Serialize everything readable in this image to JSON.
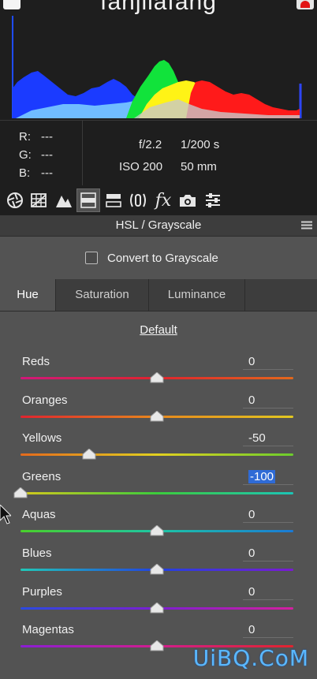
{
  "histogram": {
    "title_partial": "fanjilafang"
  },
  "info": {
    "r_label": "R:",
    "g_label": "G:",
    "b_label": "B:",
    "r_value": "---",
    "g_value": "---",
    "b_value": "---",
    "aperture": "f/2.2",
    "shutter": "1/200 s",
    "iso": "ISO 200",
    "focal_length": "50 mm"
  },
  "toolbar": {
    "active_tool": "hsl-grayscale"
  },
  "panel": {
    "title": "HSL / Grayscale",
    "convert_label": "Convert to Grayscale",
    "convert_checked": false
  },
  "tabs": {
    "hue": "Hue",
    "saturation": "Saturation",
    "luminance": "Luminance",
    "active": "Hue"
  },
  "default_label": "Default",
  "sliders": {
    "range": [
      -100,
      100
    ],
    "items": [
      {
        "label": "Reds",
        "value": "0",
        "num": 0
      },
      {
        "label": "Oranges",
        "value": "0",
        "num": 0
      },
      {
        "label": "Yellows",
        "value": "-50",
        "num": -50
      },
      {
        "label": "Greens",
        "value": "-100",
        "num": -100,
        "selected": true
      },
      {
        "label": "Aquas",
        "value": "0",
        "num": 0
      },
      {
        "label": "Blues",
        "value": "0",
        "num": 0
      },
      {
        "label": "Purples",
        "value": "0",
        "num": 0
      },
      {
        "label": "Magentas",
        "value": "0",
        "num": 0
      }
    ]
  },
  "colors": {
    "panel_bg": "#535353",
    "dark_bg": "#1e1e1e",
    "selection": "#2f6bd6",
    "watermark": "#5ab8ff"
  },
  "watermark": "UiBQ.CoM"
}
